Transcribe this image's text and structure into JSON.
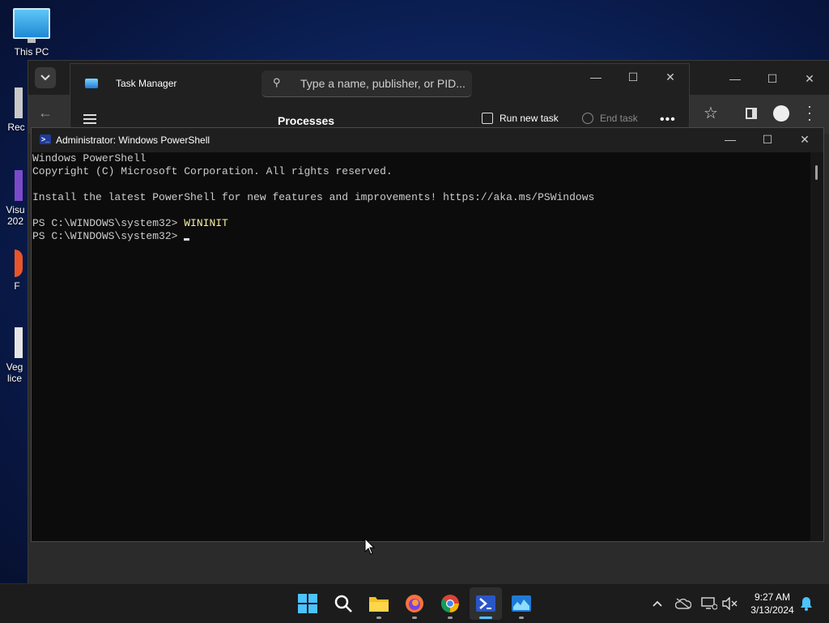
{
  "desktop": {
    "icons": [
      {
        "label": "This PC"
      },
      {
        "label": "Rec"
      },
      {
        "label": "Visu\n202"
      },
      {
        "label": "F"
      },
      {
        "label": "Veg\nlice"
      }
    ]
  },
  "task_manager": {
    "title": "Task Manager",
    "search_placeholder": "Type a name, publisher, or PID...",
    "section": "Processes",
    "run_new_task": "Run new task",
    "end_task": "End task"
  },
  "powershell": {
    "title": "Administrator: Windows PowerShell",
    "lines": [
      "Windows PowerShell",
      "Copyright (C) Microsoft Corporation. All rights reserved.",
      "",
      "Install the latest PowerShell for new features and improvements! https://aka.ms/PSWindows",
      "",
      "PS C:\\WINDOWS\\system32> ",
      "PS C:\\WINDOWS\\system32> "
    ],
    "command": "WININIT",
    "command_color": "#f9f1a5",
    "text_color": "#cccccc"
  },
  "taskbar": {
    "time": "9:27 AM",
    "date": "3/13/2024",
    "apps": [
      "start-icon",
      "search-icon",
      "file-explorer-icon",
      "firefox-icon",
      "chrome-icon",
      "powershell-icon",
      "task-manager-icon"
    ]
  }
}
